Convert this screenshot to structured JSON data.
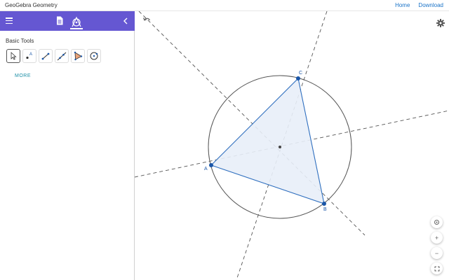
{
  "app": {
    "title": "GeoGebra Geometry"
  },
  "nav": {
    "home": "Home",
    "download": "Download"
  },
  "toolbar": {
    "menu_icon": "hamburger-menu-icon",
    "doc_icon": "document-icon",
    "tools_icon": "geometry-tools-icon",
    "collapse_icon": "chevron-left-icon",
    "color": "#6557d2"
  },
  "tools": {
    "section_title": "Basic Tools",
    "items": [
      {
        "icon": "move-arrow-icon",
        "active": true
      },
      {
        "icon": "point-icon",
        "active": false
      },
      {
        "icon": "segment-icon",
        "active": false
      },
      {
        "icon": "line-icon",
        "active": false
      },
      {
        "icon": "polygon-icon",
        "active": false
      },
      {
        "icon": "circle-center-point-icon",
        "active": false
      }
    ],
    "more_label": "MORE"
  },
  "construction": {
    "points": [
      {
        "label": "A"
      },
      {
        "label": "B"
      },
      {
        "label": "C"
      }
    ],
    "triangle_fill": "#e8eef8",
    "triangle_stroke": "#2f6fbf",
    "circle_stroke": "#555555"
  },
  "canvas_controls": {
    "undo_icon": "undo-icon",
    "settings_icon": "gear-icon",
    "buttons": [
      "home-view-icon",
      "zoom-in-icon",
      "zoom-out-icon",
      "fullscreen-icon"
    ],
    "zoom_in": "+",
    "zoom_out": "−"
  }
}
